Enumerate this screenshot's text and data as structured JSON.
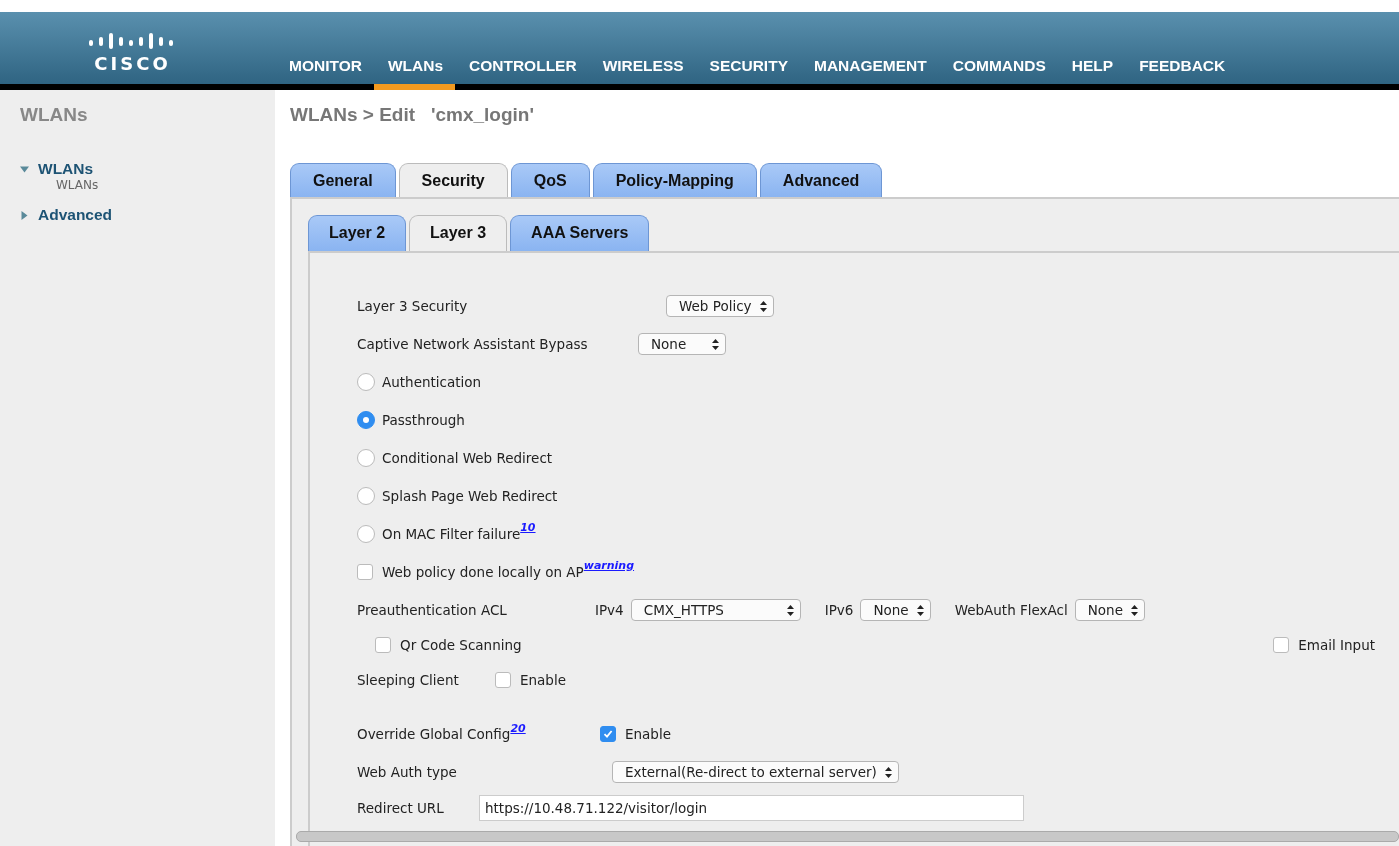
{
  "header": {
    "logo_text": "CISCO",
    "nav": [
      {
        "label": "MONITOR",
        "selected": false
      },
      {
        "label": "WLANs",
        "selected": true
      },
      {
        "label": "CONTROLLER",
        "selected": false
      },
      {
        "label": "WIRELESS",
        "selected": false
      },
      {
        "label": "SECURITY",
        "selected": false
      },
      {
        "label": "MANAGEMENT",
        "selected": false
      },
      {
        "label": "COMMANDS",
        "selected": false
      },
      {
        "label": "HELP",
        "selected": false
      },
      {
        "label": "FEEDBACK",
        "selected": false
      }
    ]
  },
  "sidebar": {
    "title": "WLANs",
    "items": [
      {
        "label": "WLANs",
        "expanded": true,
        "children": [
          {
            "label": "WLANs"
          }
        ]
      },
      {
        "label": "Advanced",
        "expanded": false
      }
    ]
  },
  "page_title": "WLANs > Edit   'cmx_login'",
  "tabs": [
    {
      "label": "General",
      "selected": false
    },
    {
      "label": "Security",
      "selected": true
    },
    {
      "label": "QoS",
      "selected": false
    },
    {
      "label": "Policy-Mapping",
      "selected": false
    },
    {
      "label": "Advanced",
      "selected": false
    }
  ],
  "subtabs": [
    {
      "label": "Layer 2",
      "selected": false
    },
    {
      "label": "Layer 3",
      "selected": true
    },
    {
      "label": "AAA Servers",
      "selected": false
    }
  ],
  "form": [
    {
      "kind": "select",
      "label": "Layer 3 Security",
      "value": "Web Policy"
    },
    {
      "kind": "select",
      "label": "Captive Network Assistant Bypass",
      "value": "None"
    },
    {
      "kind": "radio",
      "label": "Authentication",
      "selected": false
    },
    {
      "kind": "radio",
      "label": "Passthrough",
      "selected": true
    },
    {
      "kind": "radio",
      "label": "Conditional Web Redirect",
      "selected": false
    },
    {
      "kind": "radio",
      "label": "Splash Page Web Redirect",
      "selected": false
    },
    {
      "kind": "radio",
      "label": "On MAC Filter failure",
      "note": "10",
      "selected": false
    },
    {
      "kind": "checkbox",
      "label": "Web policy done locally on AP",
      "note": "warning",
      "checked": false
    },
    {
      "kind": "acl",
      "label": "Preauthentication ACL",
      "fields": [
        {
          "label": "IPv4",
          "value": "CMX_HTTPS"
        },
        {
          "label": "IPv6",
          "value": "None"
        },
        {
          "label": "WebAuth FlexAcl",
          "value": "None"
        }
      ]
    },
    {
      "kind": "checkpair",
      "items": [
        {
          "label": "Qr Code Scanning",
          "checked": false
        },
        {
          "label": "Email Input",
          "checked": false
        }
      ]
    },
    {
      "kind": "enable",
      "label": "Sleeping Client",
      "option": "Enable",
      "checked": false
    },
    {
      "kind": "enable",
      "label": "Override Global Config",
      "note": "20",
      "option": "Enable",
      "checked": true
    },
    {
      "kind": "select",
      "label": "Web Auth type",
      "value": "External(Re-direct to external server)"
    },
    {
      "kind": "input",
      "label": "Redirect URL",
      "value": "https://10.48.71.122/visitor/login"
    }
  ]
}
